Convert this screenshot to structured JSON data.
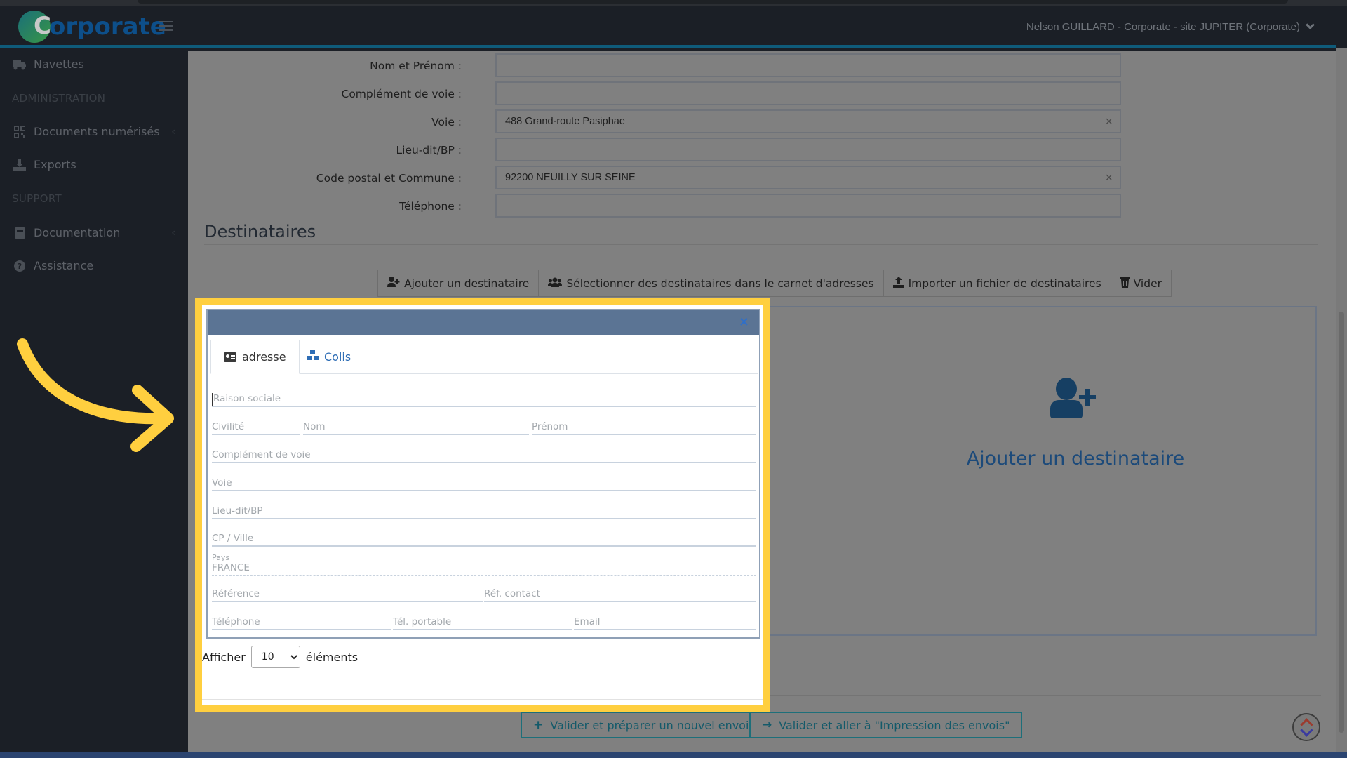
{
  "app": {
    "logo_initial": "C",
    "logo_rest": "orporate",
    "menu_icon": "hamburger-icon",
    "user_label": "Nelson GUILLARD - Corporate - site JUPITER (Corporate)",
    "accent_color": "#0f5b7a"
  },
  "sidebar": {
    "items": [
      {
        "label": "Navettes",
        "icon": "truck-icon"
      },
      {
        "section": "ADMINISTRATION"
      },
      {
        "label": "Documents numérisés",
        "icon": "qrcode-icon",
        "has_submenu": true
      },
      {
        "label": "Exports",
        "icon": "download-icon"
      },
      {
        "section": "SUPPORT"
      },
      {
        "label": "Documentation",
        "icon": "book-icon",
        "has_submenu": true
      },
      {
        "label": "Assistance",
        "icon": "question-circle-icon"
      }
    ]
  },
  "sender_form": {
    "fields": [
      {
        "label": "Nom et Prénom :",
        "value": ""
      },
      {
        "label": "Complément de voie :",
        "value": ""
      },
      {
        "label": "Voie :",
        "value": "488 Grand-route Pasiphae",
        "clearable": true
      },
      {
        "label": "Lieu-dit/BP :",
        "value": ""
      },
      {
        "label": "Code postal et Commune :",
        "value": "92200 NEUILLY SUR SEINE",
        "clearable": true
      },
      {
        "label": "Téléphone :",
        "value": ""
      }
    ],
    "clear_glyph": "×"
  },
  "recipients": {
    "title": "Destinataires",
    "buttons": [
      {
        "label": "Ajouter un destinataire",
        "icon": "user-plus-icon"
      },
      {
        "label": "Sélectionner des destinataires dans le carnet d'adresses",
        "icon": "users-icon"
      },
      {
        "label": "Importer un fichier de destinataires",
        "icon": "upload-icon"
      },
      {
        "label": "Vider",
        "icon": "trash-icon"
      }
    ],
    "empty_state_label": "Ajouter un destinataire"
  },
  "modal": {
    "close_glyph": "×",
    "tabs": [
      {
        "label": "adresse",
        "icon": "id-card-icon",
        "active": true
      },
      {
        "label": "Colis",
        "icon": "cubes-icon",
        "active": false
      }
    ],
    "fields": {
      "raison_sociale": "Raison sociale",
      "civilite": "Civilité",
      "nom": "Nom",
      "prenom": "Prénom",
      "complement": "Complément de voie",
      "voie": "Voie",
      "lieu_dit": "Lieu-dit/BP",
      "cp_ville": "CP / Ville",
      "pays_label": "Pays",
      "pays_value": "FRANCE",
      "reference": "Référence",
      "ref_contact": "Réf. contact",
      "telephone": "Téléphone",
      "tel_portable": "Tél. portable",
      "email": "Email"
    }
  },
  "table_length": {
    "prefix": "Afficher",
    "selected": "10",
    "suffix": "éléments"
  },
  "footer": {
    "buttons": [
      {
        "label": "Valider et préparer un nouvel envoi",
        "icon": "plus-icon",
        "glyph": "+"
      },
      {
        "label": "Valider et aller à \"Impression des envois\"",
        "icon": "arrow-right-icon",
        "glyph": "→"
      }
    ]
  },
  "annotation": {
    "highlight_color": "#ffcf3f"
  }
}
